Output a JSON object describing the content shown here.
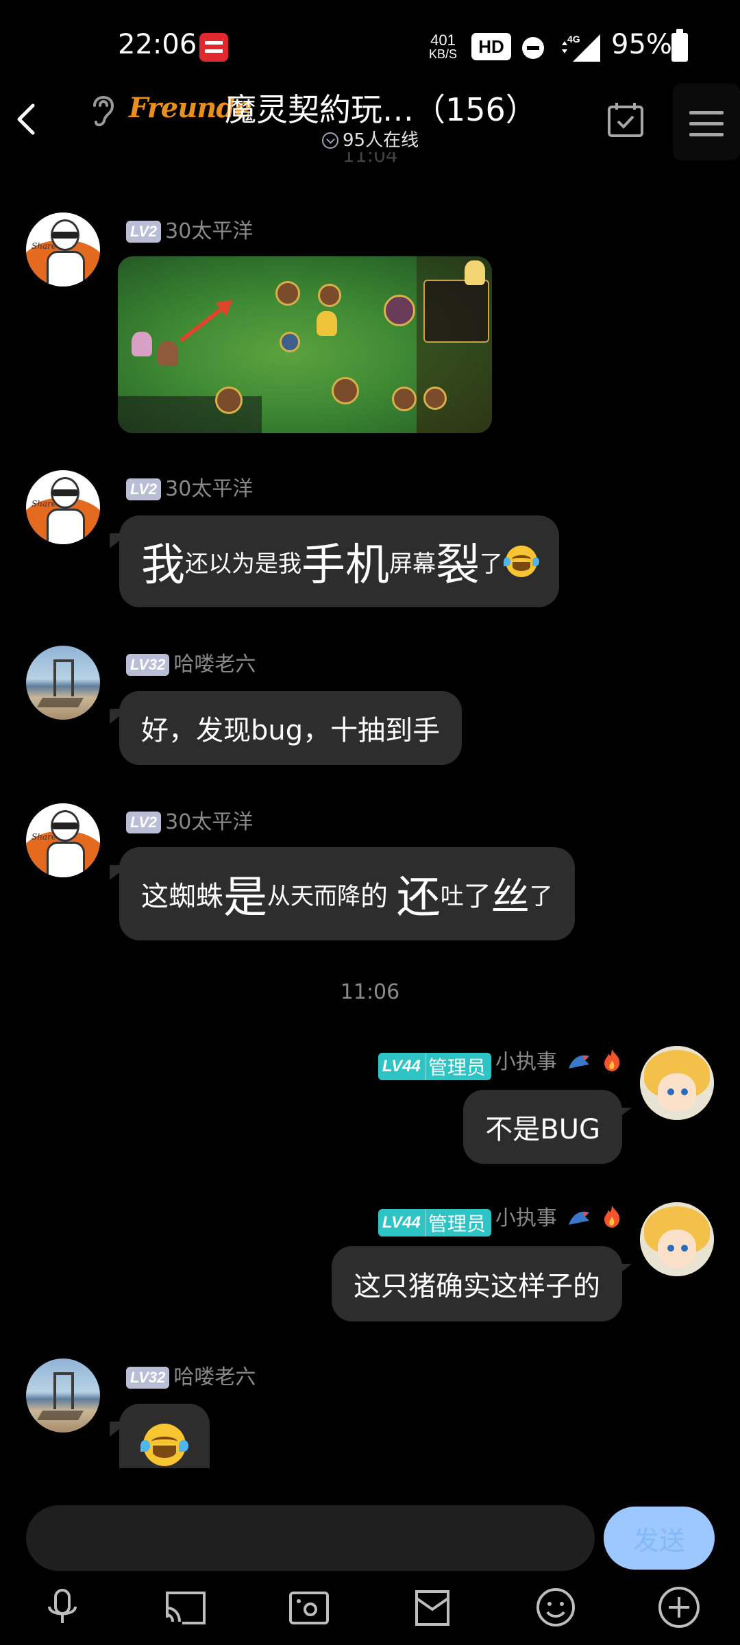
{
  "status_bar": {
    "time": "22:06",
    "net_speed_value": "401",
    "net_speed_unit": "KB/S",
    "hd_label": "HD",
    "signal_label": "4G",
    "battery": "95%"
  },
  "header": {
    "logo_text": "Freunde",
    "title": "魔灵契約玩…（156）",
    "online": "95人在线"
  },
  "partial_time": "11:04",
  "messages": [
    {
      "level": "LV2",
      "sender": "30太平洋",
      "type": "image"
    },
    {
      "level": "LV2",
      "sender": "30太平洋",
      "segments": [
        "我",
        "还以为是我",
        "手机",
        "屏幕",
        "裂",
        "了"
      ]
    },
    {
      "level": "LV32",
      "sender": "哈喽老六",
      "text": "好，发现bug，十抽到手"
    },
    {
      "level": "LV2",
      "sender": "30太平洋",
      "segments": [
        "这蜘蛛",
        "是",
        "从天而降",
        "的 ",
        "还",
        "吐",
        "了",
        "丝",
        "了"
      ]
    },
    {
      "level": "LV44",
      "role": "管理员",
      "sender": "小执事",
      "text": "不是BUG"
    },
    {
      "level": "LV44",
      "role": "管理员",
      "sender": "小执事",
      "text": "这只猪确实这样子的"
    },
    {
      "level": "LV32",
      "sender": "哈喽老六",
      "type": "emoji"
    }
  ],
  "divider_time": "11:06",
  "input": {
    "placeholder": "",
    "send_label": "发送"
  },
  "colors": {
    "admin_badge": "#2ec4c6",
    "level_badge": "#b9bdd6",
    "bubble": "#2d2d2d",
    "send_button": "#9cc7ff",
    "background": "#000000"
  },
  "toolbar_icons": [
    "microphone-icon",
    "screen-cast-icon",
    "photo-icon",
    "bag-icon",
    "emoji-icon",
    "plus-icon"
  ]
}
